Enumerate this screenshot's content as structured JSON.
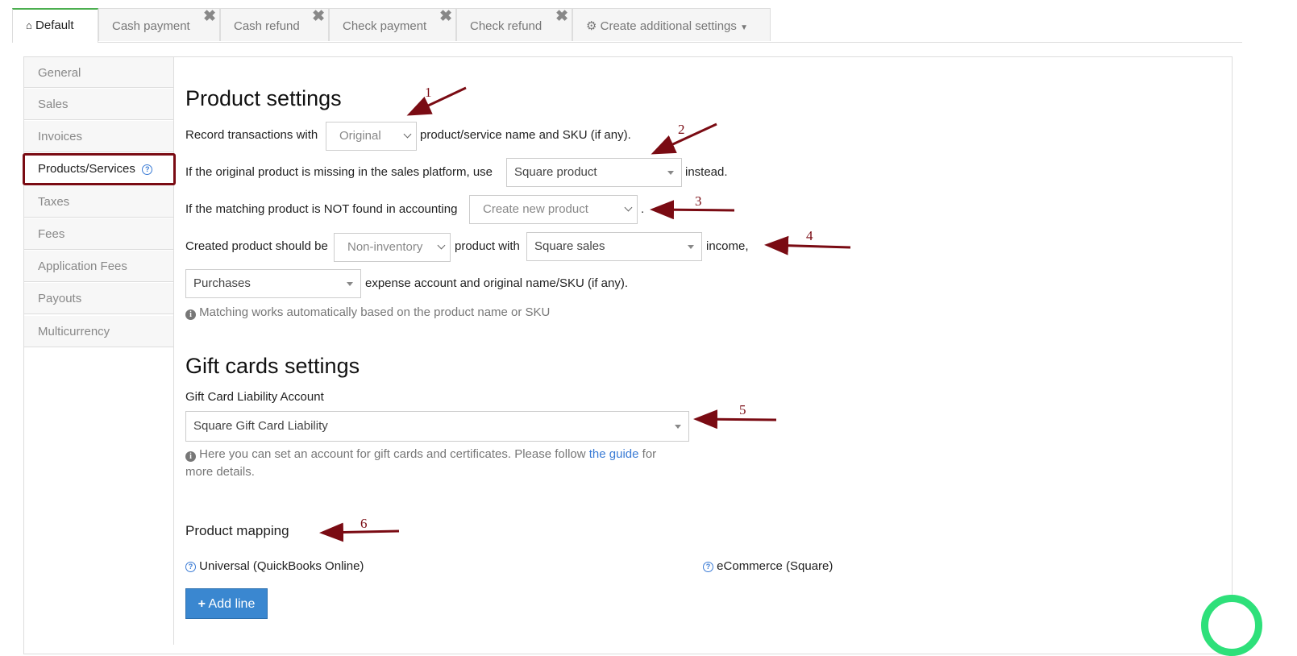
{
  "tabs": [
    {
      "label": "Default",
      "icon": "home-icon"
    },
    {
      "label": "Cash payment",
      "close": "✖"
    },
    {
      "label": "Cash refund",
      "close": "✖"
    },
    {
      "label": "Check payment",
      "close": "✖"
    },
    {
      "label": "Check refund",
      "close": "✖"
    },
    {
      "label": "Create additional settings",
      "icon": "gear-icon"
    }
  ],
  "sidebar": {
    "items": [
      "General",
      "Sales",
      "Invoices",
      "Products/Services",
      "Taxes",
      "Fees",
      "Application Fees",
      "Payouts",
      "Multicurrency"
    ],
    "active_help": "?"
  },
  "product_settings": {
    "title": "Product settings",
    "row1": {
      "before": "Record transactions with",
      "select": "Original",
      "after": "product/service name and SKU (if any)."
    },
    "row2": {
      "before": "If the original product is missing in the sales platform, use",
      "select": "Square product",
      "after": "instead."
    },
    "row3": {
      "before": "If the matching product is NOT found in accounting",
      "select": "Create new product",
      "after": "."
    },
    "row4": {
      "before": "Created product should be",
      "select1": "Non-inventory",
      "middle": "product with",
      "select2": "Square sales",
      "after": "income,"
    },
    "row5": {
      "select": "Purchases",
      "after": "expense account and original name/SKU (if any)."
    },
    "hint": "Matching works automatically based on the product name or SKU"
  },
  "gift_cards": {
    "title": "Gift cards settings",
    "label": "Gift Card Liability Account",
    "select": "Square Gift Card Liability",
    "hint_before": "Here you can set an account for gift cards and certificates. Please follow",
    "hint_link": "the guide",
    "hint_after": "for",
    "hint_line2": "more details."
  },
  "product_mapping": {
    "title": "Product mapping",
    "col1": "Universal (QuickBooks Online)",
    "col2": "eCommerce (Square)",
    "add_button": "Add line",
    "help": "?"
  },
  "annotations": [
    "1",
    "2",
    "3",
    "4",
    "5",
    "6"
  ],
  "colors": {
    "annotation": "#7a0b13",
    "primary": "#3a87d0",
    "active_tab": "#4caf50",
    "chat": "#2ee07a"
  }
}
